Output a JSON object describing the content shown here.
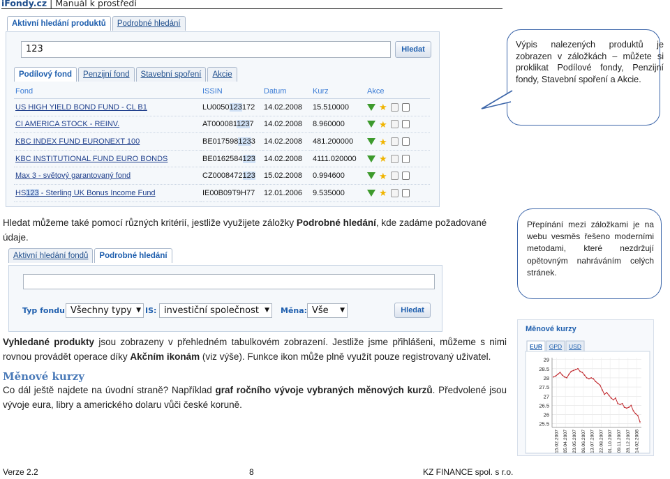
{
  "header": {
    "brand": "iFondy.cz",
    "title": "Manuál k prostředí"
  },
  "search1": {
    "tabs": [
      "Aktivní hledání produktů",
      "Podrobné hledání"
    ],
    "query": "123",
    "button": "Hledat",
    "result_tabs": [
      "Podílový fond",
      "Penzijní fond",
      "Stavební spoření",
      "Akcie"
    ],
    "columns": [
      "Fond",
      "ISSIN",
      "Datum",
      "Kurz",
      "Akce"
    ],
    "rows": [
      {
        "fond": "US HIGH YIELD BOND FUND - CL B1",
        "isin": "LU0050123172",
        "datum": "14.02.2008",
        "kurz": "15.510000"
      },
      {
        "fond": "CI AMERICA STOCK - REINV.",
        "isin": "AT0000811237",
        "datum": "14.02.2008",
        "kurz": "8.960000"
      },
      {
        "fond": "KBC INDEX FUND EURONEXT 100",
        "isin": "BE0175981233",
        "datum": "14.02.2008",
        "kurz": "481.200000"
      },
      {
        "fond": "KBC INSTITUTIONAL FUND EURO BONDS",
        "isin": "BE0162584123",
        "datum": "14.02.2008",
        "kurz": "4111.020000"
      },
      {
        "fond": "Max 3 - světový garantovaný fond",
        "isin": "CZ0008472123",
        "datum": "15.02.2008",
        "kurz": "0.994600"
      },
      {
        "fond": "HS123 - Sterling UK Bonus Income Fund",
        "isin": "IE00B09T9H77",
        "datum": "12.01.2006",
        "kurz": "9.535000"
      }
    ]
  },
  "callout1": "Výpis nalezených produktů je zobrazen v záložkách – můžete si proklikat Podílové fondy, Penzijní fondy, Stavební spoření a Akcie.",
  "para1": {
    "a": "Hledat můžeme také pomocí různých kritérií, jestliže využijete záložky ",
    "b": "Podrobné hledání",
    "c": ", kde zadáme požadované údaje."
  },
  "callout2": "Přepínání mezi záložkami je na webu vesměs řešeno moderními metodami, které nezdržují opětovným nahráváním celých stránek.",
  "search2": {
    "tabs": [
      "Aktivní hledání fondů",
      "Podrobné hledání"
    ],
    "type_label": "Typ fondu:",
    "type_value": "Všechny typy",
    "is_label": "IS:",
    "is_value": "investiční společnost",
    "currency_label": "Měna:",
    "currency_value": "Vše",
    "button": "Hledat"
  },
  "para2": {
    "a": "Vyhledané produkty",
    "b": " jsou zobrazeny v přehledném tabulkovém zobrazení. Jestliže jsme přihlášeni, můžeme s nimi rovnou provádět operace díky ",
    "c": "Akčním ikonám",
    "d": " (viz výše). Funkce ikon může plně využít pouze registrovaný uživatel."
  },
  "section_title": "Měnové kurzy",
  "para3": {
    "a": "Co dál ještě najdete na úvodní straně? Například ",
    "b": "graf ročního vývoje vybraných měnových kurzů",
    "c": ". Předvolené jsou vývoje eura, libry a amerického dolaru vůči české koruně."
  },
  "chart_data": {
    "type": "line",
    "title": "Měnové kurzy",
    "tabs": [
      "EUR",
      "GPD",
      "USD"
    ],
    "active_tab": "EUR",
    "ylim": [
      25.3,
      29.1
    ],
    "yticks": [
      "29",
      "28.5",
      "28",
      "27.5",
      "27",
      "26.5",
      "26",
      "25.5"
    ],
    "xticks": [
      "15.02.2007",
      "05.04.2007",
      "23.05.2007",
      "06.06.2007",
      "13.07.2007",
      "22.08.2007",
      "01.10.2007",
      "09.11.2007",
      "28.12.2007",
      "14.02.2008"
    ],
    "series": [
      {
        "values": [
          28.05,
          28.1,
          28.2,
          28.3,
          28.15,
          28.05,
          28.0,
          28.2,
          28.35,
          28.4,
          28.45,
          28.5,
          28.35,
          28.3,
          28.15,
          28.0,
          27.95,
          28.0,
          27.95,
          27.8,
          27.7,
          27.6,
          27.35,
          27.1,
          27.2,
          27.05,
          26.9,
          26.8,
          26.9,
          26.6,
          26.55,
          26.6,
          26.4,
          26.35,
          26.4,
          26.5,
          26.2,
          26.05,
          25.95,
          25.6
        ]
      }
    ],
    "line_color": "#c0282d"
  },
  "footer": {
    "version": "Verze 2.2",
    "page": "8",
    "company": "KZ FINANCE spol. s r.o."
  }
}
